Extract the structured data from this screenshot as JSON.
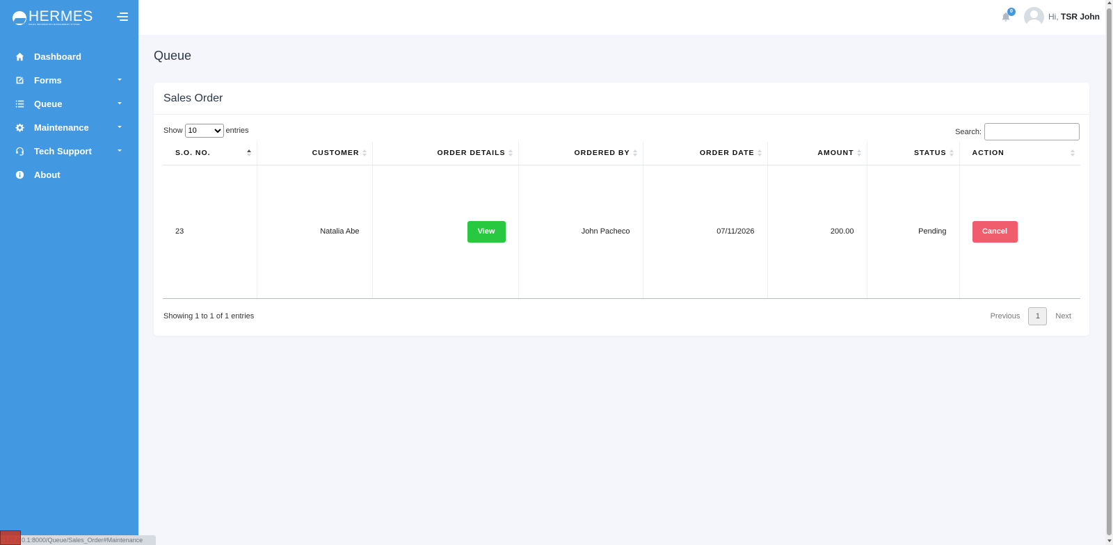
{
  "brand": {
    "name": "HERMES",
    "tagline": "SALES INFORMATION MANAGEMENT SYSTEM"
  },
  "sidebar": {
    "items": [
      {
        "label": "Dashboard",
        "icon": "home-icon",
        "has_caret": false
      },
      {
        "label": "Forms",
        "icon": "edit-icon",
        "has_caret": true
      },
      {
        "label": "Queue",
        "icon": "list-icon",
        "has_caret": true
      },
      {
        "label": "Maintenance",
        "icon": "gear-icon",
        "has_caret": true
      },
      {
        "label": "Tech Support",
        "icon": "headset-icon",
        "has_caret": true
      },
      {
        "label": "About",
        "icon": "info-icon",
        "has_caret": false
      }
    ]
  },
  "topbar": {
    "notification_count": "0",
    "greeting_prefix": "Hi,",
    "user_name": "TSR John"
  },
  "page": {
    "title": "Queue"
  },
  "card": {
    "title": "Sales Order",
    "length": {
      "show_label": "Show",
      "selected": "10",
      "entries_label": "entries"
    },
    "search_label": "Search:",
    "search_value": "",
    "columns": [
      "S.O. NO.",
      "CUSTOMER",
      "ORDER DETAILS",
      "ORDERED BY",
      "ORDER DATE",
      "AMOUNT",
      "STATUS",
      "ACTION"
    ],
    "rows": [
      {
        "so_no": "23",
        "customer": "Natalia Abe",
        "details_button": "View",
        "ordered_by": "John Pacheco",
        "order_date": "07/11/2026",
        "amount": "200.00",
        "status": "Pending",
        "action_button": "Cancel"
      }
    ],
    "info": "Showing 1 to 1 of 1 entries",
    "pagination": {
      "previous": "Previous",
      "current_page": "1",
      "next": "Next"
    }
  },
  "statusbar": {
    "url": "127.0.0.1:8000/Queue/Sales_Order#Maintenance"
  },
  "colors": {
    "sidebar": "#4299e1",
    "view_button": "#28c940",
    "cancel_button": "#f05d6c",
    "background": "#f4f6fb"
  }
}
